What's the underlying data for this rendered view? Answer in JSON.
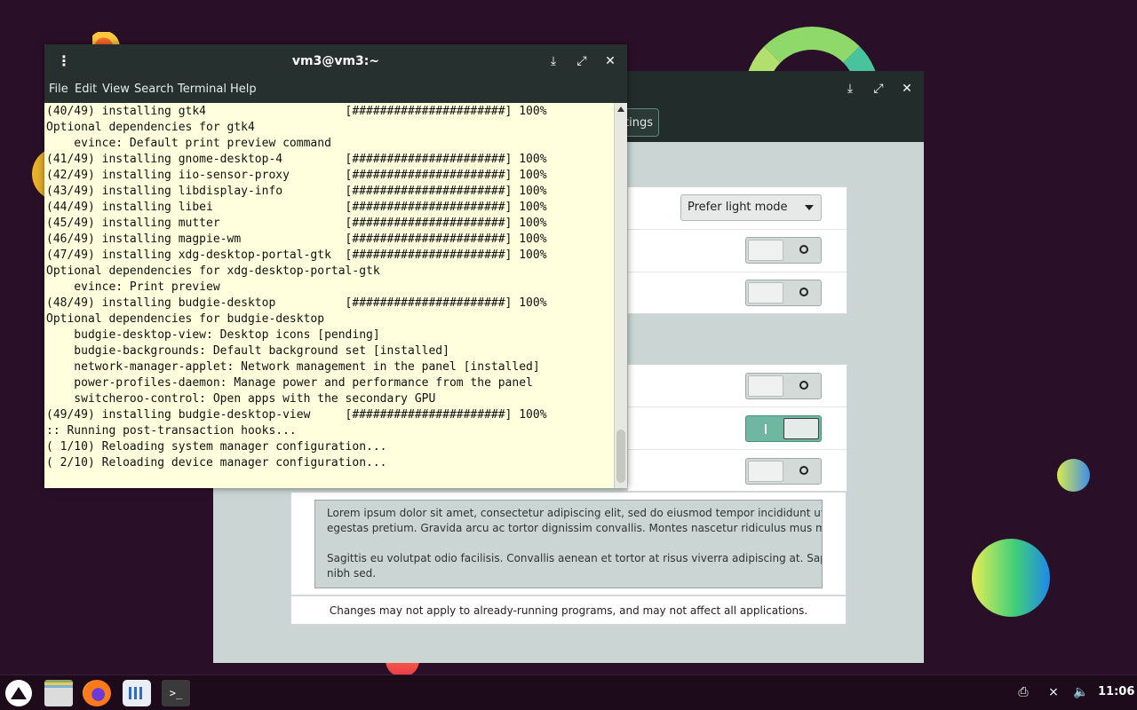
{
  "terminal": {
    "title": "vm3@vm3:~",
    "menu": [
      "File",
      "Edit",
      "View",
      "Search",
      "Terminal",
      "Help"
    ],
    "lines": [
      "(40/49) installing gtk4                    [######################] 100%",
      "Optional dependencies for gtk4",
      "    evince: Default print preview command",
      "(41/49) installing gnome-desktop-4         [######################] 100%",
      "(42/49) installing iio-sensor-proxy        [######################] 100%",
      "(43/49) installing libdisplay-info         [######################] 100%",
      "(44/49) installing libei                   [######################] 100%",
      "(45/49) installing mutter                  [######################] 100%",
      "(46/49) installing magpie-wm               [######################] 100%",
      "(47/49) installing xdg-desktop-portal-gtk  [######################] 100%",
      "Optional dependencies for xdg-desktop-portal-gtk",
      "    evince: Print preview",
      "(48/49) installing budgie-desktop          [######################] 100%",
      "Optional dependencies for budgie-desktop",
      "    budgie-desktop-view: Desktop icons [pending]",
      "    budgie-backgrounds: Default background set [installed]",
      "    network-manager-applet: Network management in the panel [installed]",
      "    power-profiles-daemon: Manage power and performance from the panel",
      "    switcheroo-control: Open apps with the secondary GPU",
      "(49/49) installing budgie-desktop-view     [######################] 100%",
      ":: Running post-transaction hooks...",
      "( 1/10) Reloading system manager configuration...",
      "( 2/10) Reloading device manager configuration..."
    ]
  },
  "settings": {
    "tab_label": "ttings",
    "theme_dropdown": "Prefer light mode",
    "toggles": [
      false,
      false,
      false,
      true,
      false
    ],
    "lorem": [
      "Lorem ipsum dolor sit amet, consectetur adipiscing elit, sed do eiusmod tempor incididunt ut labore e",
      "egestas pretium. Gravida arcu ac tortor dignissim convallis. Montes nascetur ridiculus mus mauris vi",
      "Sagittis eu volutpat odio facilisis. Convallis aenean et tortor at risus viverra adipiscing at. Sapien et lig",
      "nibh sed."
    ],
    "note": "Changes may not apply to already-running programs, and may not affect all applications."
  },
  "taskbar": {
    "clock": "11:06",
    "apps": [
      "launcher-icon",
      "files-icon",
      "firefox-icon",
      "system-monitor-icon",
      "terminal-icon"
    ],
    "tray": [
      "printer-icon",
      "network-disconnected-icon",
      "volume-icon"
    ]
  }
}
